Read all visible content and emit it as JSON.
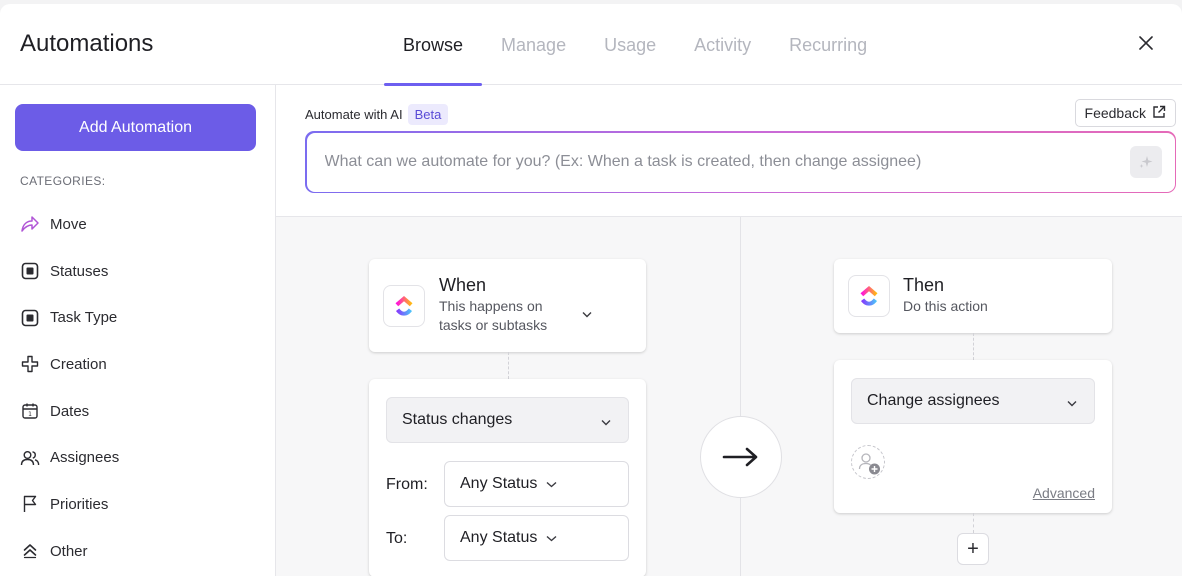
{
  "header": {
    "title": "Automations",
    "tabs": [
      {
        "label": "Browse",
        "active": true
      },
      {
        "label": "Manage",
        "active": false
      },
      {
        "label": "Usage",
        "active": false
      },
      {
        "label": "Activity",
        "active": false
      },
      {
        "label": "Recurring",
        "active": false
      }
    ],
    "close_icon": "close-icon"
  },
  "sidebar": {
    "add_button_label": "Add Automation",
    "categories_label": "CATEGORIES:",
    "categories": [
      {
        "label": "Move",
        "icon": "move-arrow-icon"
      },
      {
        "label": "Statuses",
        "icon": "status-square-icon"
      },
      {
        "label": "Task Type",
        "icon": "task-type-square-icon"
      },
      {
        "label": "Creation",
        "icon": "creation-plus-icon"
      },
      {
        "label": "Dates",
        "icon": "calendar-icon"
      },
      {
        "label": "Assignees",
        "icon": "users-icon"
      },
      {
        "label": "Priorities",
        "icon": "flag-icon"
      },
      {
        "label": "Other",
        "icon": "other-icon"
      }
    ]
  },
  "ai": {
    "label": "Automate with AI",
    "badge": "Beta",
    "placeholder": "What can we automate for you? (Ex: When a task is created, then change assignee)",
    "feedback_label": "Feedback"
  },
  "trigger": {
    "title": "When",
    "subtitle_line1": "This happens on",
    "subtitle_line2": "tasks or subtasks",
    "select_value": "Status changes",
    "from_label": "From:",
    "from_value": "Any Status",
    "to_label": "To:",
    "to_value": "Any Status"
  },
  "action": {
    "title": "Then",
    "subtitle": "Do this action",
    "select_value": "Change assignees",
    "advanced_label": "Advanced",
    "add_label": "+"
  },
  "colors": {
    "accent": "#6c5ce7",
    "tab_active_underline": "#6d5ff0",
    "beta_bg": "#eceafd",
    "beta_text": "#5a4bd6"
  }
}
